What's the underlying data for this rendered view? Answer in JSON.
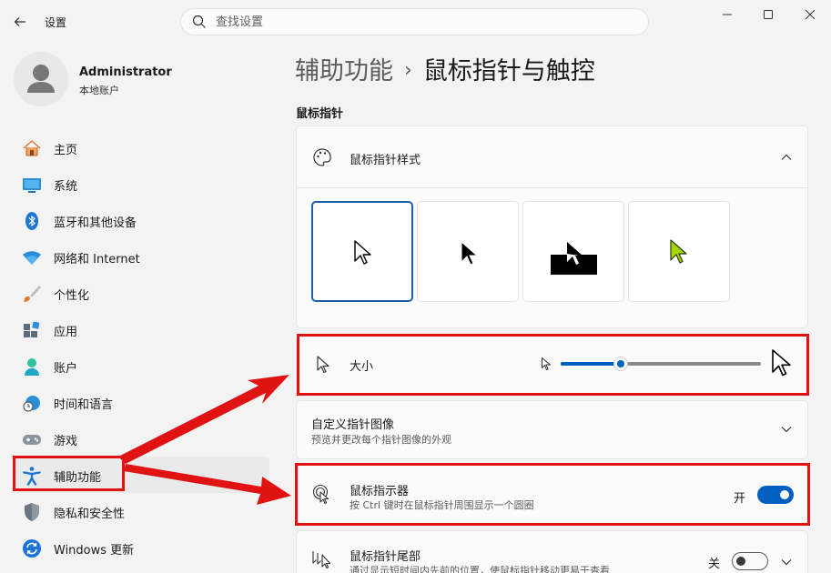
{
  "window": {
    "title": "设置",
    "search_placeholder": "查找设置"
  },
  "profile": {
    "name": "Administrator",
    "account_type": "本地账户"
  },
  "sidebar": {
    "items": [
      {
        "label": "主页",
        "icon": "home-icon"
      },
      {
        "label": "系统",
        "icon": "system-icon"
      },
      {
        "label": "蓝牙和其他设备",
        "icon": "bluetooth-icon"
      },
      {
        "label": "网络和 Internet",
        "icon": "wifi-icon"
      },
      {
        "label": "个性化",
        "icon": "brush-icon"
      },
      {
        "label": "应用",
        "icon": "apps-icon"
      },
      {
        "label": "账户",
        "icon": "account-icon"
      },
      {
        "label": "时间和语言",
        "icon": "clock-globe-icon"
      },
      {
        "label": "游戏",
        "icon": "gamepad-icon"
      },
      {
        "label": "辅助功能",
        "icon": "accessibility-icon"
      },
      {
        "label": "隐私和安全性",
        "icon": "shield-icon"
      },
      {
        "label": "Windows 更新",
        "icon": "update-icon"
      }
    ],
    "active_index": 9
  },
  "breadcrumb": {
    "parent": "辅助功能",
    "separator": "›",
    "current": "鼠标指针与触控"
  },
  "main": {
    "section_label": "鼠标指针",
    "pointer_style": {
      "title": "鼠标指针样式",
      "tiles": [
        "white",
        "black",
        "inverted",
        "custom"
      ],
      "selected": "white",
      "custom_color": "#a6d608"
    },
    "size": {
      "title": "大小",
      "value": 0.3
    },
    "custom_image": {
      "title": "自定义指针图像",
      "description": "预览并更改每个指针图像的外观"
    },
    "indicator": {
      "title": "鼠标指示器",
      "description": "按 Ctrl 键时在鼠标指针周围显示一个圆圈",
      "state_label": "开",
      "on": true
    },
    "trail": {
      "title": "鼠标指针尾部",
      "description": "通过显示短时间内先前的位置，使鼠标指针移动更易于查看",
      "state_label": "关",
      "on": false
    }
  },
  "colors": {
    "accent": "#0060bf",
    "highlight": "#e01212"
  }
}
